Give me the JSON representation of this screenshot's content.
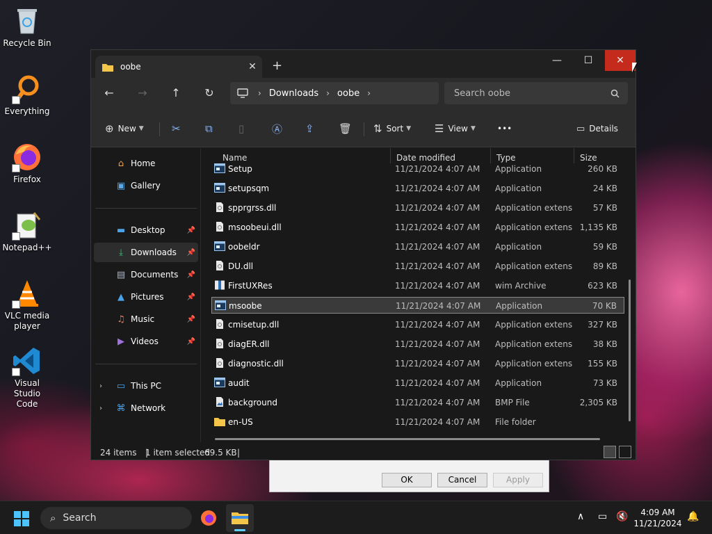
{
  "desktop": {
    "icons": [
      {
        "label": "Recycle Bin",
        "icon": "recycle-bin-icon"
      },
      {
        "label": "Everything",
        "icon": "everything-search-icon"
      },
      {
        "label": "Firefox",
        "icon": "firefox-icon"
      },
      {
        "label": "Notepad++",
        "icon": "notepad-plus-plus-icon"
      },
      {
        "label": "VLC media player",
        "icon": "vlc-icon"
      },
      {
        "label": "Visual Studio Code",
        "icon": "vscode-icon"
      }
    ]
  },
  "background_dialog": {
    "ok": "OK",
    "cancel": "Cancel",
    "apply": "Apply"
  },
  "window": {
    "tab_title": "oobe",
    "new_tab": "+",
    "controls": {
      "minimize": "—",
      "maximize": "☐",
      "close": "✕"
    },
    "address": {
      "crumbs": [
        "Downloads",
        "oobe"
      ]
    },
    "search_placeholder": "Search oobe",
    "commands": {
      "new": "New",
      "sort": "Sort",
      "view": "View",
      "more": "•••",
      "details": "Details"
    },
    "sidebar": {
      "quick": [
        {
          "label": "Home",
          "icon": "home-icon"
        },
        {
          "label": "Gallery",
          "icon": "gallery-icon"
        }
      ],
      "pinned": [
        {
          "label": "Desktop",
          "icon": "desktop-folder-icon"
        },
        {
          "label": "Downloads",
          "icon": "downloads-folder-icon"
        },
        {
          "label": "Documents",
          "icon": "documents-folder-icon"
        },
        {
          "label": "Pictures",
          "icon": "pictures-folder-icon"
        },
        {
          "label": "Music",
          "icon": "music-folder-icon"
        },
        {
          "label": "Videos",
          "icon": "videos-folder-icon"
        }
      ],
      "roots": [
        {
          "label": "This PC",
          "icon": "this-pc-icon"
        },
        {
          "label": "Network",
          "icon": "network-icon"
        }
      ]
    },
    "columns": {
      "name": "Name",
      "date": "Date modified",
      "type": "Type",
      "size": "Size"
    },
    "files": [
      {
        "name": "Setup",
        "date": "11/21/2024 4:07 AM",
        "type": "Application",
        "size": "260 KB",
        "icon": "application-icon"
      },
      {
        "name": "setupsqm",
        "date": "11/21/2024 4:07 AM",
        "type": "Application",
        "size": "24 KB",
        "icon": "application-icon"
      },
      {
        "name": "spprgrss.dll",
        "date": "11/21/2024 4:07 AM",
        "type": "Application extens...",
        "size": "57 KB",
        "icon": "dll-file-icon"
      },
      {
        "name": "msoobeui.dll",
        "date": "11/21/2024 4:07 AM",
        "type": "Application extens...",
        "size": "1,135 KB",
        "icon": "dll-file-icon"
      },
      {
        "name": "oobeldr",
        "date": "11/21/2024 4:07 AM",
        "type": "Application",
        "size": "59 KB",
        "icon": "application-icon"
      },
      {
        "name": "DU.dll",
        "date": "11/21/2024 4:07 AM",
        "type": "Application extens...",
        "size": "89 KB",
        "icon": "dll-file-icon"
      },
      {
        "name": "FirstUXRes",
        "date": "11/21/2024 4:07 AM",
        "type": "wim Archive",
        "size": "623 KB",
        "icon": "wim-archive-icon"
      },
      {
        "name": "msoobe",
        "date": "11/21/2024 4:07 AM",
        "type": "Application",
        "size": "70 KB",
        "icon": "application-icon",
        "selected": true
      },
      {
        "name": "cmisetup.dll",
        "date": "11/21/2024 4:07 AM",
        "type": "Application extens...",
        "size": "327 KB",
        "icon": "dll-file-icon"
      },
      {
        "name": "diagER.dll",
        "date": "11/21/2024 4:07 AM",
        "type": "Application extens...",
        "size": "38 KB",
        "icon": "dll-file-icon"
      },
      {
        "name": "diagnostic.dll",
        "date": "11/21/2024 4:07 AM",
        "type": "Application extens...",
        "size": "155 KB",
        "icon": "dll-file-icon"
      },
      {
        "name": "audit",
        "date": "11/21/2024 4:07 AM",
        "type": "Application",
        "size": "73 KB",
        "icon": "application-icon"
      },
      {
        "name": "background",
        "date": "11/21/2024 4:07 AM",
        "type": "BMP File",
        "size": "2,305 KB",
        "icon": "bmp-file-icon"
      },
      {
        "name": "en-US",
        "date": "11/21/2024 4:07 AM",
        "type": "File folder",
        "size": "",
        "icon": "folder-icon"
      }
    ],
    "status": {
      "items": "24 items",
      "selected": "1 item selected",
      "size": "69.5 KB"
    }
  },
  "taskbar": {
    "search_label": "Search",
    "time": "4:09 AM",
    "date": "11/21/2024"
  },
  "colors": {
    "accent": "#60cdff",
    "close_red": "#c42b1c",
    "folder_yellow": "#f3c64a"
  }
}
